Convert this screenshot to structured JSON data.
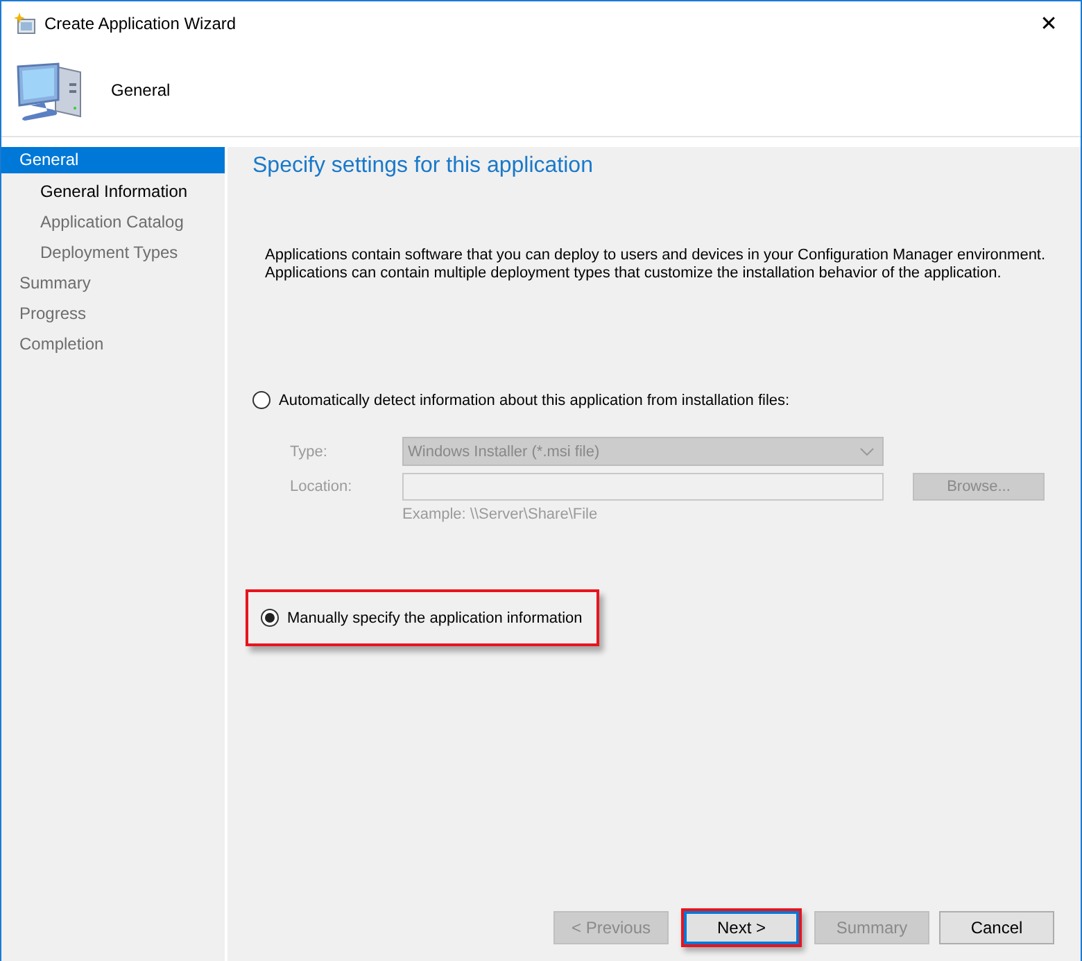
{
  "window": {
    "title": "Create Application Wizard",
    "close": "✕"
  },
  "header": {
    "title": "General"
  },
  "sidebar": {
    "items": [
      {
        "label": "General",
        "selected": true,
        "dimmed": false,
        "children": [
          {
            "label": "General Information",
            "selected": false,
            "dimmed": false
          },
          {
            "label": "Application Catalog",
            "selected": false,
            "dimmed": true
          },
          {
            "label": "Deployment Types",
            "selected": false,
            "dimmed": true
          }
        ]
      },
      {
        "label": "Summary",
        "selected": false,
        "dimmed": true
      },
      {
        "label": "Progress",
        "selected": false,
        "dimmed": true
      },
      {
        "label": "Completion",
        "selected": false,
        "dimmed": true
      }
    ]
  },
  "page": {
    "heading": "Specify settings for this application",
    "description": "Applications contain software that you can deploy to users and devices in your Configuration Manager environment. Applications can contain multiple deployment types that customize the installation behavior of the application.",
    "options": [
      {
        "label": "Automatically detect information about this application from installation files:",
        "selected": false,
        "highlighted": false,
        "fields": {
          "disabled": true,
          "type_label": "Type:",
          "type_value": "Windows Installer (*.msi file)",
          "location_label": "Location:",
          "browse": "Browse...",
          "example": "Example: \\\\Server\\Share\\File"
        }
      },
      {
        "label": "Manually specify the application information",
        "selected": true,
        "highlighted": true
      }
    ]
  },
  "buttons": [
    {
      "label": "< Previous",
      "disabled": true,
      "default": false,
      "highlighted": false
    },
    {
      "label": "Next >",
      "disabled": false,
      "default": true,
      "highlighted": true
    },
    {
      "label": "Summary",
      "disabled": true,
      "default": false,
      "highlighted": false
    },
    {
      "label": "Cancel",
      "disabled": false,
      "default": false,
      "highlighted": false
    }
  ]
}
